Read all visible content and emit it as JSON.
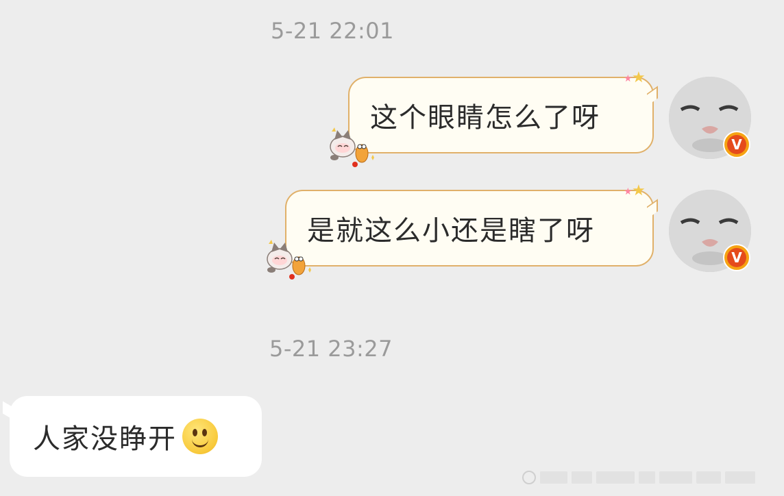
{
  "chat": {
    "timestamps": [
      "5-21 22:01",
      "5-21 23:27"
    ],
    "outgoing": [
      {
        "text": "这个眼睛怎么了呀"
      },
      {
        "text": "是就这么小还是瞎了呀"
      }
    ],
    "incoming": [
      {
        "text": "人家没睁开",
        "emoji": "smile-emoji"
      }
    ],
    "avatar_badge": "V"
  },
  "colors": {
    "background": "#ededed",
    "outgoing_bubble_fill": "#fffdf3",
    "outgoing_bubble_border": "#e0b069",
    "incoming_bubble_fill": "#ffffff",
    "timestamp": "#9a9a9a",
    "badge_orange": "#f6a313",
    "badge_red": "#e54b1b"
  }
}
